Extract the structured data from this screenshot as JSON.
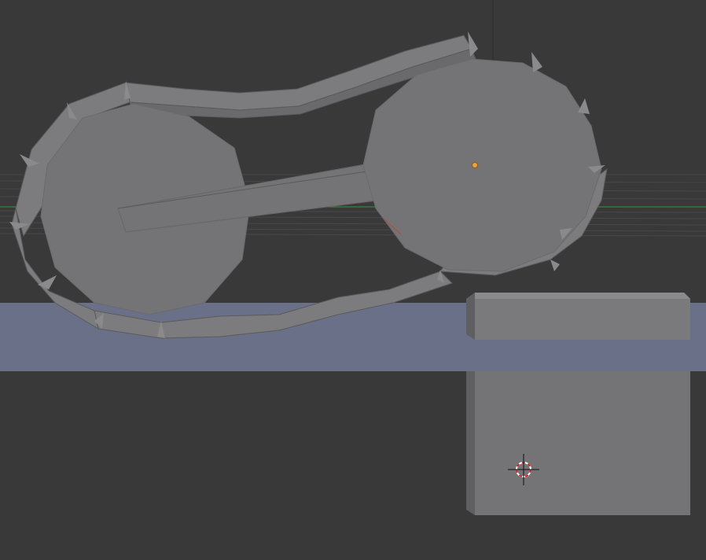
{
  "viewport": {
    "background_color": "#393939",
    "grid_color": "#4a4a4a",
    "x_axis_color": "#2e9a2e",
    "y_axis_color": "#3a3a3a",
    "mesh_face_color": "#747476",
    "mesh_edge_dark_color": "#5a5a5c",
    "mesh_edge_light_color": "#8a8a8c",
    "ground_plane_color": "#6b7089",
    "origin_dot_color": "#f0a040",
    "cursor_icon": "3d-cursor-icon",
    "cursor_ring_colors": [
      "#cc2222",
      "#ffffff"
    ]
  }
}
